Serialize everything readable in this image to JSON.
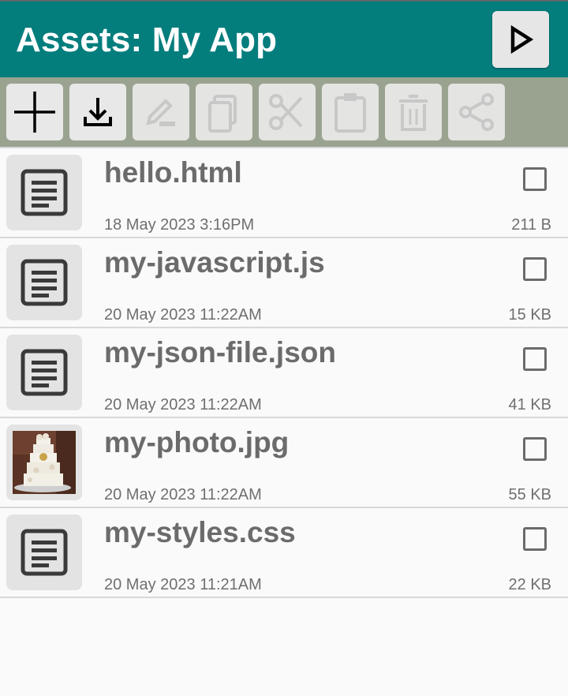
{
  "header": {
    "title": "Assets: My App",
    "run_icon": "play-icon",
    "bar_color": "#047d7d"
  },
  "toolbar": {
    "color": "#9aa390",
    "buttons": [
      {
        "icon": "add-icon",
        "enabled": true
      },
      {
        "icon": "import-download-icon",
        "enabled": true
      },
      {
        "icon": "rename-pencil-icon",
        "enabled": false
      },
      {
        "icon": "copy-icon",
        "enabled": false
      },
      {
        "icon": "cut-scissors-icon",
        "enabled": false
      },
      {
        "icon": "paste-clipboard-icon",
        "enabled": false
      },
      {
        "icon": "delete-trash-icon",
        "enabled": false
      },
      {
        "icon": "share-icon",
        "enabled": false
      }
    ]
  },
  "files": [
    {
      "name": "hello.html",
      "date": "18 May 2023 3:16PM",
      "size": "211 B",
      "icon": "document-icon",
      "checked": false
    },
    {
      "name": "my-javascript.js",
      "date": "20 May 2023 11:22AM",
      "size": "15 KB",
      "icon": "document-icon",
      "checked": false
    },
    {
      "name": "my-json-file.json",
      "date": "20 May 2023 11:22AM",
      "size": "41 KB",
      "icon": "document-icon",
      "checked": false
    },
    {
      "name": "my-photo.jpg",
      "date": "20 May 2023 11:22AM",
      "size": "55 KB",
      "icon": "photo-thumbnail",
      "checked": false
    },
    {
      "name": "my-styles.css",
      "date": "20 May 2023 11:21AM",
      "size": "22 KB",
      "icon": "document-icon",
      "checked": false
    }
  ]
}
